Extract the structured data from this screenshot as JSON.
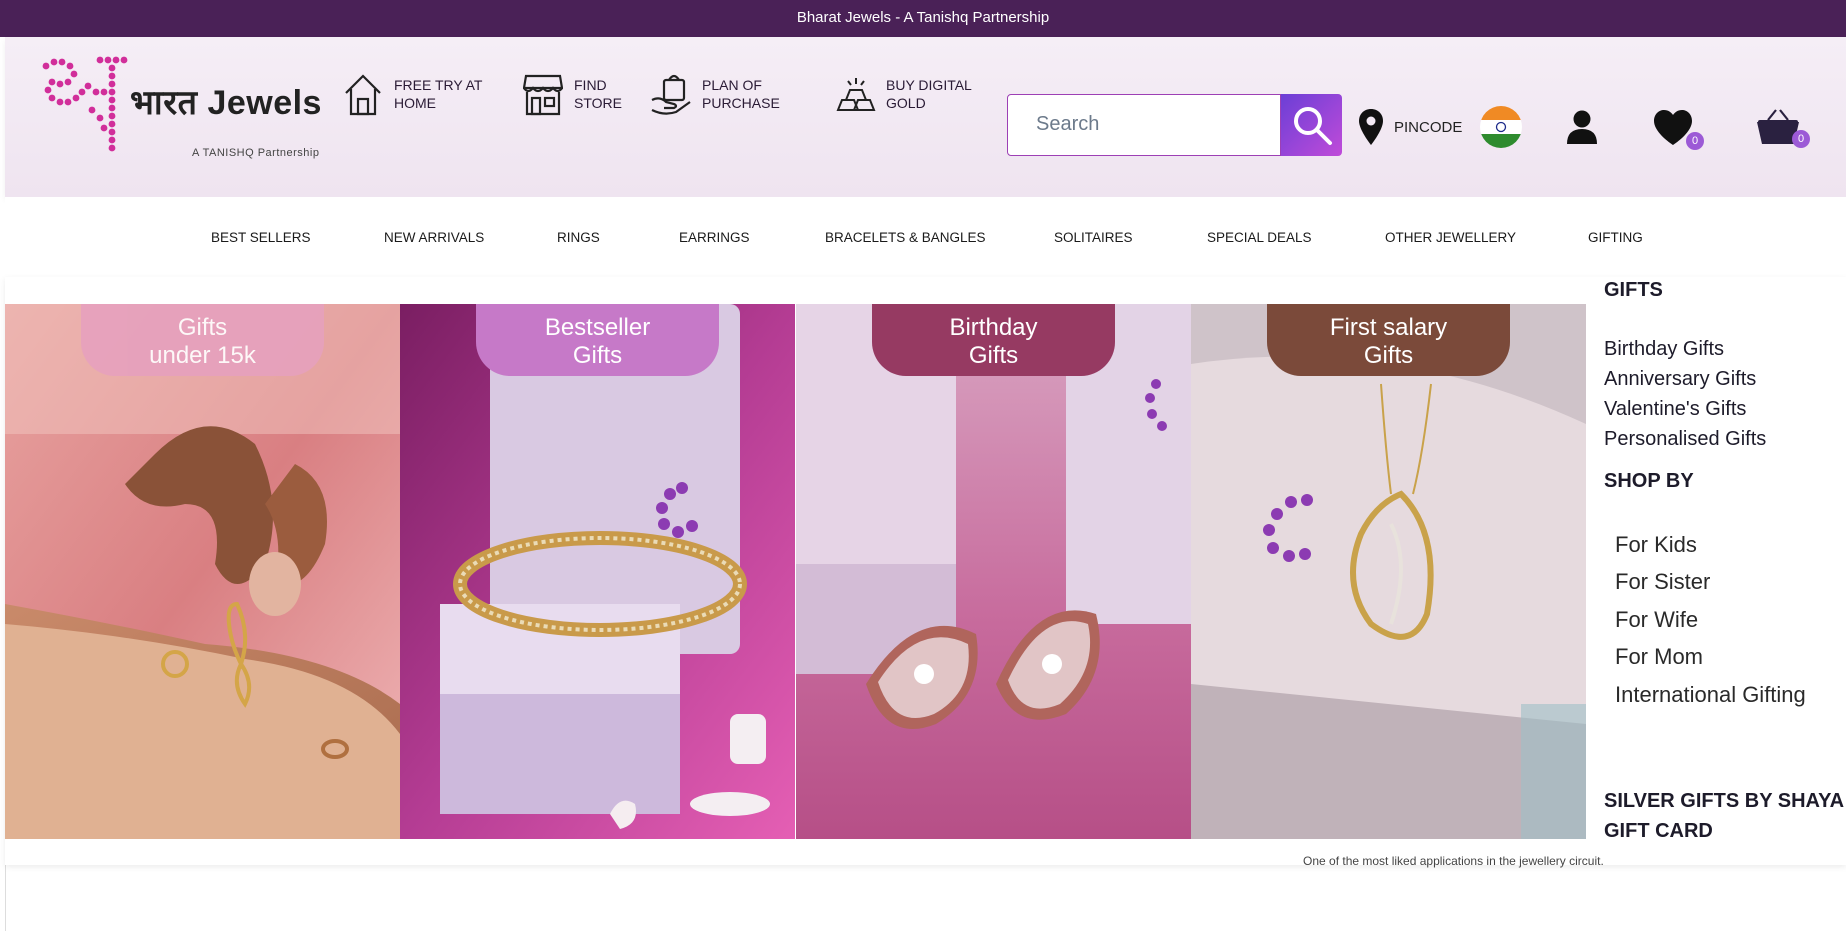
{
  "announcement": "Bharat Jewels - A Tanishq Partnership",
  "logo": {
    "name": "भारत Jewels",
    "subtitle": "A TANISHQ Partnership"
  },
  "header_items": [
    {
      "label": "FREE TRY AT HOME",
      "icon": "home-icon"
    },
    {
      "label": "FIND STORE",
      "icon": "store-icon"
    },
    {
      "label": "PLAN OF PURCHASE",
      "icon": "hand-bag-icon"
    },
    {
      "label": "BUY DIGITAL GOLD",
      "icon": "gold-bars-icon"
    }
  ],
  "search": {
    "placeholder": "Search"
  },
  "pincode": {
    "label": "PINCODE"
  },
  "counts": {
    "wishlist": "0",
    "cart": "0"
  },
  "colors": {
    "top_bar": "#4a2157",
    "accent": "#9d3fb5",
    "badge": "#9c5ad6"
  },
  "nav": [
    "BEST SELLERS",
    "NEW ARRIVALS",
    "RINGS",
    "EARRINGS",
    "BRACELETS & BANGLES",
    "SOLITAIRES",
    "SPECIAL DEALS",
    "OTHER JEWELLERY",
    "GIFTING"
  ],
  "tiles": [
    {
      "line1": "Gifts",
      "line2": "under 15k",
      "tag_color": "#e6a1bd"
    },
    {
      "line1": "Bestseller",
      "line2": "Gifts",
      "tag_color": "#c679c8"
    },
    {
      "line1": "Birthday",
      "line2": "Gifts",
      "tag_color": "#963a62"
    },
    {
      "line1": "First salary",
      "line2": "Gifts",
      "tag_color": "#7b4a3a"
    }
  ],
  "side": {
    "gifts_heading": "GIFTS",
    "gifts": [
      "Birthday Gifts",
      "Anniversary Gifts",
      "Valentine's Gifts",
      "Personalised Gifts"
    ],
    "shop_by_heading": "SHOP BY",
    "shop_by": [
      "For Kids",
      "For Sister",
      "For Wife",
      "For Mom",
      "International Gifting"
    ],
    "silver": "SILVER GIFTS BY SHAYA",
    "gift_card": "GIFT CARD"
  },
  "footer_fragment": "One of the most liked applications in the jewellery circuit."
}
